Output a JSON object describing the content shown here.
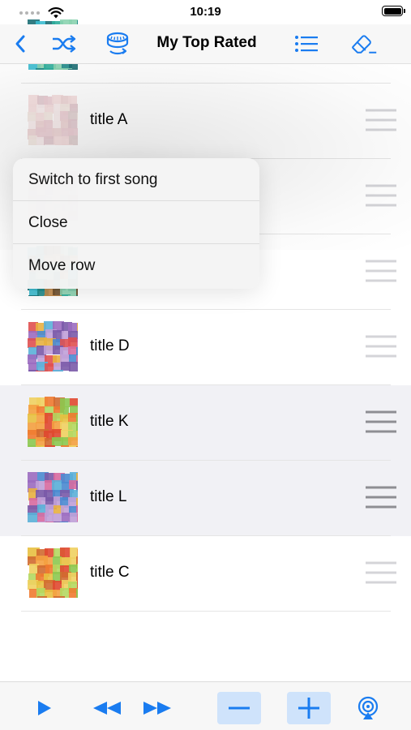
{
  "status_bar": {
    "time": "10:19"
  },
  "nav": {
    "title": "My Top Rated",
    "icons": [
      "chevron-left-icon",
      "shuffle-icon",
      "rating-dial-icon",
      "list-icon",
      "eraser-icon"
    ],
    "accent_color": "#1a7cf0"
  },
  "songs": [
    {
      "title": "",
      "selected": false,
      "art_palette": "teal"
    },
    {
      "title": "title A",
      "selected": false,
      "art_palette": "pale"
    },
    {
      "title": "",
      "selected": false,
      "art_palette": "pale"
    },
    {
      "title": "",
      "selected": false,
      "art_palette": "teal"
    },
    {
      "title": "title D",
      "selected": false,
      "art_palette": "purple"
    },
    {
      "title": "title K",
      "selected": true,
      "art_palette": "warm"
    },
    {
      "title": "title L",
      "selected": true,
      "art_palette": "purple"
    },
    {
      "title": "title C",
      "selected": false,
      "art_palette": "warm"
    }
  ],
  "context_menu": {
    "items": [
      "Switch to first song",
      "Close",
      "Move row"
    ]
  },
  "toolbar": {
    "icons": [
      "play-icon",
      "rewind-icon",
      "fast-forward-icon",
      "minus-icon",
      "plus-icon",
      "airplay-icon"
    ]
  }
}
